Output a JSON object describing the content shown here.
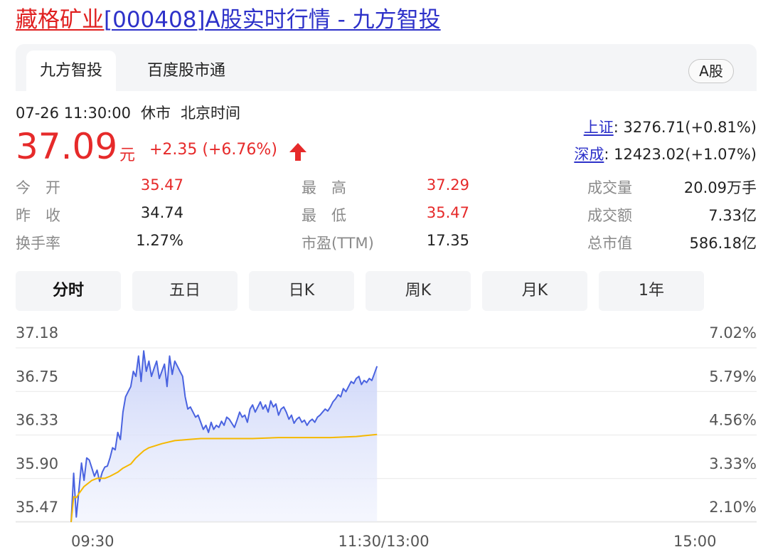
{
  "header": {
    "stock_name": "藏格矿业",
    "title_rest": "[000408]A股实时行情 - 九方智投"
  },
  "tabs": [
    {
      "label": "九方智投",
      "active": true
    },
    {
      "label": "百度股市通",
      "active": false
    }
  ],
  "market_badge": "A股",
  "status": {
    "datetime": "07-26 11:30:00",
    "state": "休市",
    "timezone": "北京时间"
  },
  "quote": {
    "price": "37.09",
    "unit": "元",
    "change": "+2.35 (+6.76%)",
    "direction": "up",
    "color_up": "#e62a2a"
  },
  "indices": [
    {
      "name": "上证",
      "value": ": 3276.71(+0.81%)"
    },
    {
      "name": "深成",
      "value": ": 12423.02(+1.07%)"
    }
  ],
  "stats": [
    {
      "label": "今　开",
      "value": "35.47",
      "color": "red"
    },
    {
      "label": "最　高",
      "value": "37.29",
      "color": "red"
    },
    {
      "label": "成交量",
      "value": "20.09万手",
      "color": "dark"
    },
    {
      "label": "昨　收",
      "value": "34.74",
      "color": "dark"
    },
    {
      "label": "最　低",
      "value": "35.47",
      "color": "red"
    },
    {
      "label": "成交额",
      "value": "7.33亿",
      "color": "dark"
    },
    {
      "label": "换手率",
      "value": "1.27%",
      "color": "dark"
    },
    {
      "label": "市盈(TTM)",
      "value": "17.35",
      "color": "dark"
    },
    {
      "label": "总市值",
      "value": "586.18亿",
      "color": "dark"
    }
  ],
  "periods": [
    {
      "label": "分时",
      "active": true
    },
    {
      "label": "五日",
      "active": false
    },
    {
      "label": "日K",
      "active": false
    },
    {
      "label": "周K",
      "active": false
    },
    {
      "label": "月K",
      "active": false
    },
    {
      "label": "1年",
      "active": false
    }
  ],
  "chart_data": {
    "type": "area",
    "y_left_ticks": [
      "37.18",
      "36.75",
      "36.33",
      "35.90",
      "35.47"
    ],
    "y_right_ticks": [
      "7.02%",
      "5.79%",
      "4.56%",
      "3.33%",
      "2.10%"
    ],
    "x_ticks": [
      "09:30",
      "11:30/13:00",
      "15:00"
    ],
    "ylim": [
      35.47,
      37.18
    ],
    "session_minutes": 240,
    "grid": true,
    "colors": {
      "price": "#4a63e0",
      "avg": "#f5b800",
      "fill": "#dfe4fb"
    },
    "series": [
      {
        "role": "price",
        "x": [
          0,
          1,
          2,
          3,
          4,
          5,
          6,
          7,
          8,
          9,
          10,
          11,
          12,
          13,
          14,
          15,
          16,
          17,
          18,
          19,
          20,
          21,
          22,
          23,
          24,
          25,
          26,
          27,
          28,
          29,
          30,
          31,
          32,
          33,
          34,
          35,
          36,
          37,
          38,
          39,
          40,
          41,
          42,
          43,
          44,
          45,
          46,
          47,
          48,
          49,
          50,
          51,
          52,
          53,
          54,
          55,
          56,
          57,
          58,
          59,
          60,
          61,
          62,
          63,
          64,
          65,
          66,
          67,
          68,
          69,
          70,
          71,
          72,
          73,
          74,
          75,
          76,
          77,
          78,
          79,
          80,
          81,
          82,
          83,
          84,
          85,
          86,
          87,
          88,
          89,
          90,
          91,
          92,
          93,
          94,
          95,
          96,
          97,
          98,
          99,
          100,
          101,
          102,
          103,
          104,
          105,
          106,
          107,
          108,
          109,
          110,
          111,
          112,
          113,
          114,
          115,
          116,
          117,
          118
        ],
        "y": [
          35.47,
          35.95,
          35.52,
          35.78,
          36.05,
          35.88,
          36.1,
          36.08,
          36.0,
          35.92,
          35.98,
          35.87,
          35.96,
          36.01,
          36.02,
          36.1,
          36.2,
          36.18,
          36.35,
          36.28,
          36.55,
          36.7,
          36.75,
          36.8,
          36.95,
          36.9,
          37.1,
          36.85,
          37.15,
          36.95,
          37.05,
          36.9,
          36.98,
          37.05,
          36.88,
          36.95,
          37.02,
          36.8,
          37.1,
          36.92,
          37.05,
          37.0,
          36.95,
          36.9,
          36.7,
          36.58,
          36.6,
          36.55,
          36.5,
          36.52,
          36.45,
          36.38,
          36.42,
          36.35,
          36.45,
          36.38,
          36.42,
          36.4,
          36.46,
          36.42,
          36.5,
          36.48,
          36.44,
          36.4,
          36.47,
          36.55,
          36.5,
          36.52,
          36.45,
          36.58,
          36.62,
          36.55,
          36.6,
          36.65,
          36.58,
          36.62,
          36.55,
          36.66,
          36.6,
          36.63,
          36.52,
          36.58,
          36.6,
          36.55,
          36.48,
          36.52,
          36.44,
          36.48,
          36.5,
          36.45,
          36.47,
          36.42,
          36.46,
          36.48,
          36.45,
          36.5,
          36.52,
          36.55,
          36.58,
          36.56,
          36.6,
          36.65,
          36.68,
          36.72,
          36.7,
          36.78,
          36.75,
          36.8,
          36.85,
          36.83,
          36.88,
          36.9,
          36.82,
          36.86,
          36.84,
          36.88,
          36.86,
          36.93,
          37.0
        ]
      },
      {
        "role": "avg",
        "x": [
          0,
          1,
          2,
          3,
          5,
          8,
          10,
          13,
          15,
          18,
          20,
          23,
          25,
          28,
          30,
          35,
          40,
          45,
          50,
          55,
          60,
          70,
          80,
          90,
          100,
          110,
          118
        ],
        "y": [
          35.47,
          35.72,
          35.71,
          35.75,
          35.82,
          35.88,
          35.9,
          35.9,
          35.92,
          35.96,
          36.0,
          36.04,
          36.1,
          36.17,
          36.2,
          36.24,
          36.27,
          36.28,
          36.29,
          36.29,
          36.29,
          36.29,
          36.3,
          36.3,
          36.3,
          36.31,
          36.33
        ]
      }
    ]
  }
}
